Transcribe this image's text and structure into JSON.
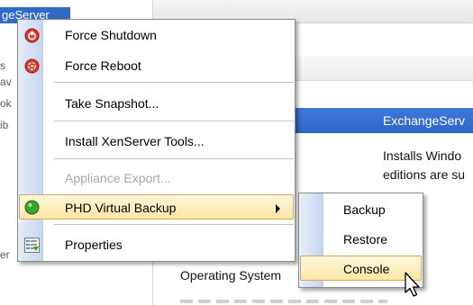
{
  "background": {
    "selected_server_label": "geServer",
    "left_edge_fragments": [
      "s",
      "av",
      "ok",
      "ib",
      "er"
    ],
    "heading_text": "ExchangeServ",
    "description_lines": [
      "Installs Windo",
      "editions are su"
    ],
    "os_label": "Operating System"
  },
  "context_menu": {
    "items": [
      {
        "label": "Force Shutdown",
        "icon": "power-off-icon",
        "enabled": true
      },
      {
        "label": "Force Reboot",
        "icon": "reboot-icon",
        "enabled": true
      },
      {
        "label": "Take Snapshot...",
        "enabled": true
      },
      {
        "label": "Install XenServer Tools...",
        "enabled": true
      },
      {
        "label": "Appliance Export...",
        "enabled": false
      },
      {
        "label": "PHD Virtual Backup",
        "icon": "green-dot-icon",
        "enabled": true,
        "has_submenu": true,
        "highlighted": true
      },
      {
        "label": "Properties",
        "icon": "properties-icon",
        "enabled": true
      }
    ]
  },
  "submenu": {
    "items": [
      {
        "label": "Backup"
      },
      {
        "label": "Restore"
      },
      {
        "label": "Console",
        "highlighted": true
      }
    ]
  },
  "colors": {
    "selection_blue": "#316ac5",
    "heading_blue": "#2f66c7",
    "menu_highlight": "#ffe7a4",
    "menu_highlight_border": "#d2a852",
    "disabled_text": "#a7a7a7"
  }
}
